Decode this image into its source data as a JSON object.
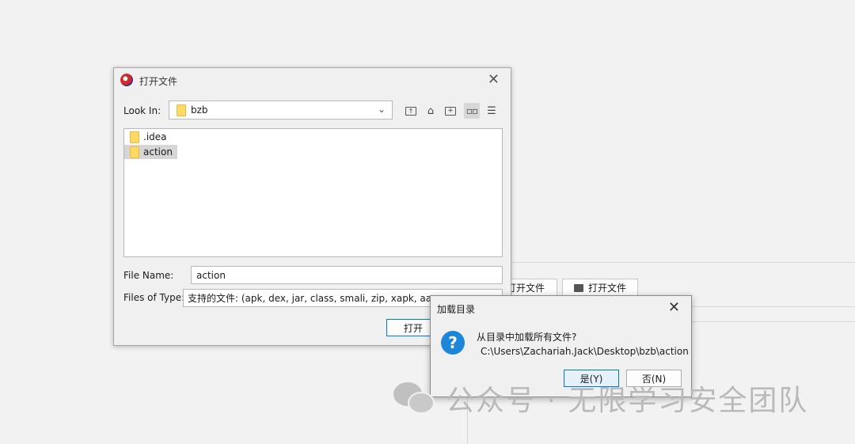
{
  "background_app": {
    "button_open_partial": "打开文件",
    "button_open_file": "打开文件"
  },
  "open_dialog": {
    "title": "打开文件",
    "look_in_label": "Look In:",
    "look_in_value": "bzb",
    "files": [
      {
        "name": ".idea",
        "selected": false
      },
      {
        "name": "action",
        "selected": true
      }
    ],
    "file_name_label": "File Name:",
    "file_name_value": "action",
    "files_of_type_label": "Files of Type:",
    "files_of_type_value": "支持的文件: (apk, dex, jar, class, smali, zip, xapk, aar, a",
    "open_button": "打开",
    "toolbar_icons": [
      "up-folder-icon",
      "home-icon",
      "new-folder-icon",
      "list-view-icon",
      "details-view-icon"
    ]
  },
  "confirm_dialog": {
    "title": "加载目录",
    "message": "从目录中加载所有文件?",
    "path": "C:\\Users\\Zachariah.Jack\\Desktop\\bzb\\action",
    "yes_button": "是(Y)",
    "no_button": "否(N)"
  },
  "watermark": {
    "text": "公众号 · 无限学习安全团队"
  }
}
